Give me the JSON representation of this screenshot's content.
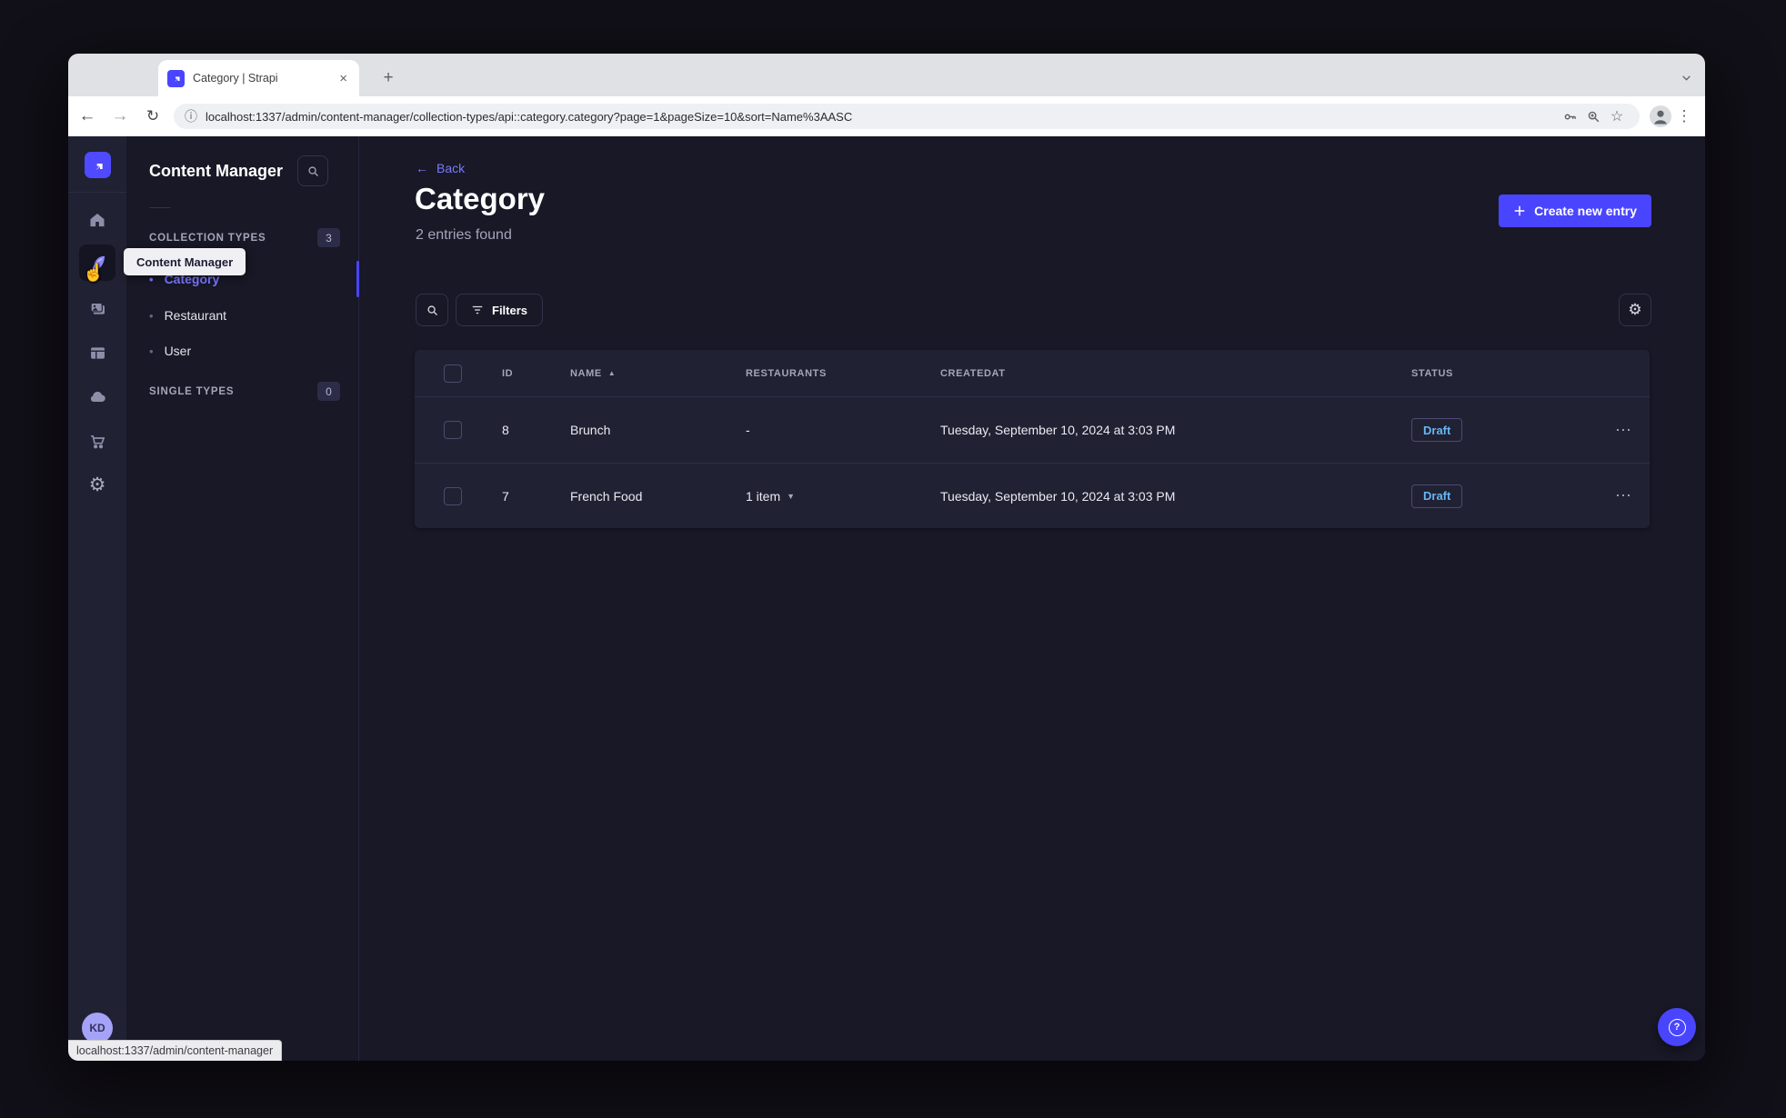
{
  "browser": {
    "tab_title": "Category | Strapi",
    "url": "localhost:1337/admin/content-manager/collection-types/api::category.category?page=1&pageSize=10&sort=Name%3AASC",
    "status_text": "localhost:1337/admin/content-manager"
  },
  "icons": {
    "back_arrow": "←",
    "forward_arrow": "→",
    "reload": "↻",
    "info": "ⓘ",
    "star": "☆",
    "overflow_menu": "⋮",
    "tab_close": "×",
    "new_tab": "+",
    "sort_asc": "▲",
    "caret_down": "▼",
    "row_actions": "⋯",
    "bullet": "•",
    "gear": "⚙",
    "hand_cursor": "☝",
    "help": "?"
  },
  "sidebar": {
    "tooltip": "Content Manager",
    "user_initials": "KD"
  },
  "subnav": {
    "title": "Content Manager",
    "sections": [
      {
        "label": "COLLECTION TYPES",
        "badge": "3",
        "items": [
          {
            "label": "Category"
          },
          {
            "label": "Restaurant"
          },
          {
            "label": "User"
          }
        ]
      },
      {
        "label": "SINGLE TYPES",
        "badge": "0",
        "items": []
      }
    ]
  },
  "main": {
    "back_label": "Back",
    "title": "Category",
    "subtitle": "2 entries found",
    "create_button": "Create new entry",
    "filters_button": "Filters",
    "table": {
      "headers": [
        "ID",
        "NAME",
        "RESTAURANTS",
        "CREATEDAT",
        "STATUS"
      ],
      "rows": [
        {
          "id": "8",
          "name": "Brunch",
          "restaurants": "-",
          "createdAt": "Tuesday, September 10, 2024 at 3:03 PM",
          "status": "Draft"
        },
        {
          "id": "7",
          "name": "French Food",
          "restaurants": "1 item",
          "createdAt": "Tuesday, September 10, 2024 at 3:03 PM",
          "status": "Draft"
        }
      ]
    }
  },
  "colors": {
    "brand": "#4945ff",
    "brand_light": "#7b79ff",
    "draft_status": "#66b7f1",
    "card_bg": "#212134",
    "app_bg": "#181826"
  }
}
